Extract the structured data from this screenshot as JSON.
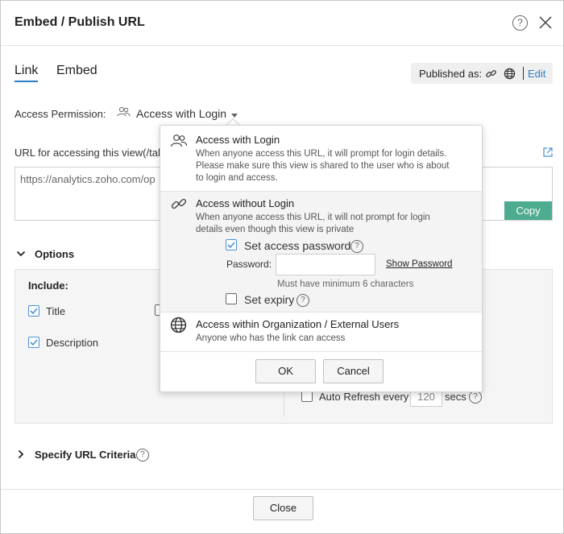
{
  "dialog": {
    "title": "Embed / Publish URL",
    "tabs": [
      "Link",
      "Embed"
    ],
    "published_as_label": "Published as:",
    "edit_label": "Edit"
  },
  "access": {
    "label": "Access Permission:",
    "value": "Access with Login"
  },
  "url": {
    "label": "URL for accessing this view(/tab",
    "value": "https://analytics.zoho.com/op",
    "copy_label": "Copy"
  },
  "options": {
    "title": "Options",
    "include_label": "Include:",
    "title_cb": {
      "label": "Title",
      "checked": true
    },
    "description_cb": {
      "label": "Description",
      "checked": true
    },
    "auto_refresh": {
      "label": "Auto Refresh every",
      "value": "120",
      "unit": "secs",
      "checked": false
    }
  },
  "url_criteria": {
    "title": "Specify URL Criteria"
  },
  "popup": {
    "options": [
      {
        "title": "Access with Login",
        "desc": "When anyone access this URL, it will prompt for login details. Please make sure this view is shared to the user who is about to login and access.",
        "icon": "users-icon"
      },
      {
        "title": "Access without Login",
        "desc": "When anyone access this URL, it will not prompt for login details even though this view is private",
        "icon": "link-icon"
      },
      {
        "title": "Access within Organization / External Users",
        "desc": "Anyone who has the link can access",
        "icon": "globe-icon"
      }
    ],
    "set_password": {
      "label": "Set access password",
      "checked": true
    },
    "password_label": "Password:",
    "password_value": "",
    "show_password": "Show Password",
    "password_hint": "Must have minimum 6 characters",
    "set_expiry": {
      "label": "Set expiry",
      "checked": false
    },
    "ok_label": "OK",
    "cancel_label": "Cancel"
  },
  "footer": {
    "close_label": "Close"
  },
  "colors": {
    "accent": "#2c7ec3",
    "copy_button": "#4dab8f",
    "checkbox": "#4a90d9"
  }
}
